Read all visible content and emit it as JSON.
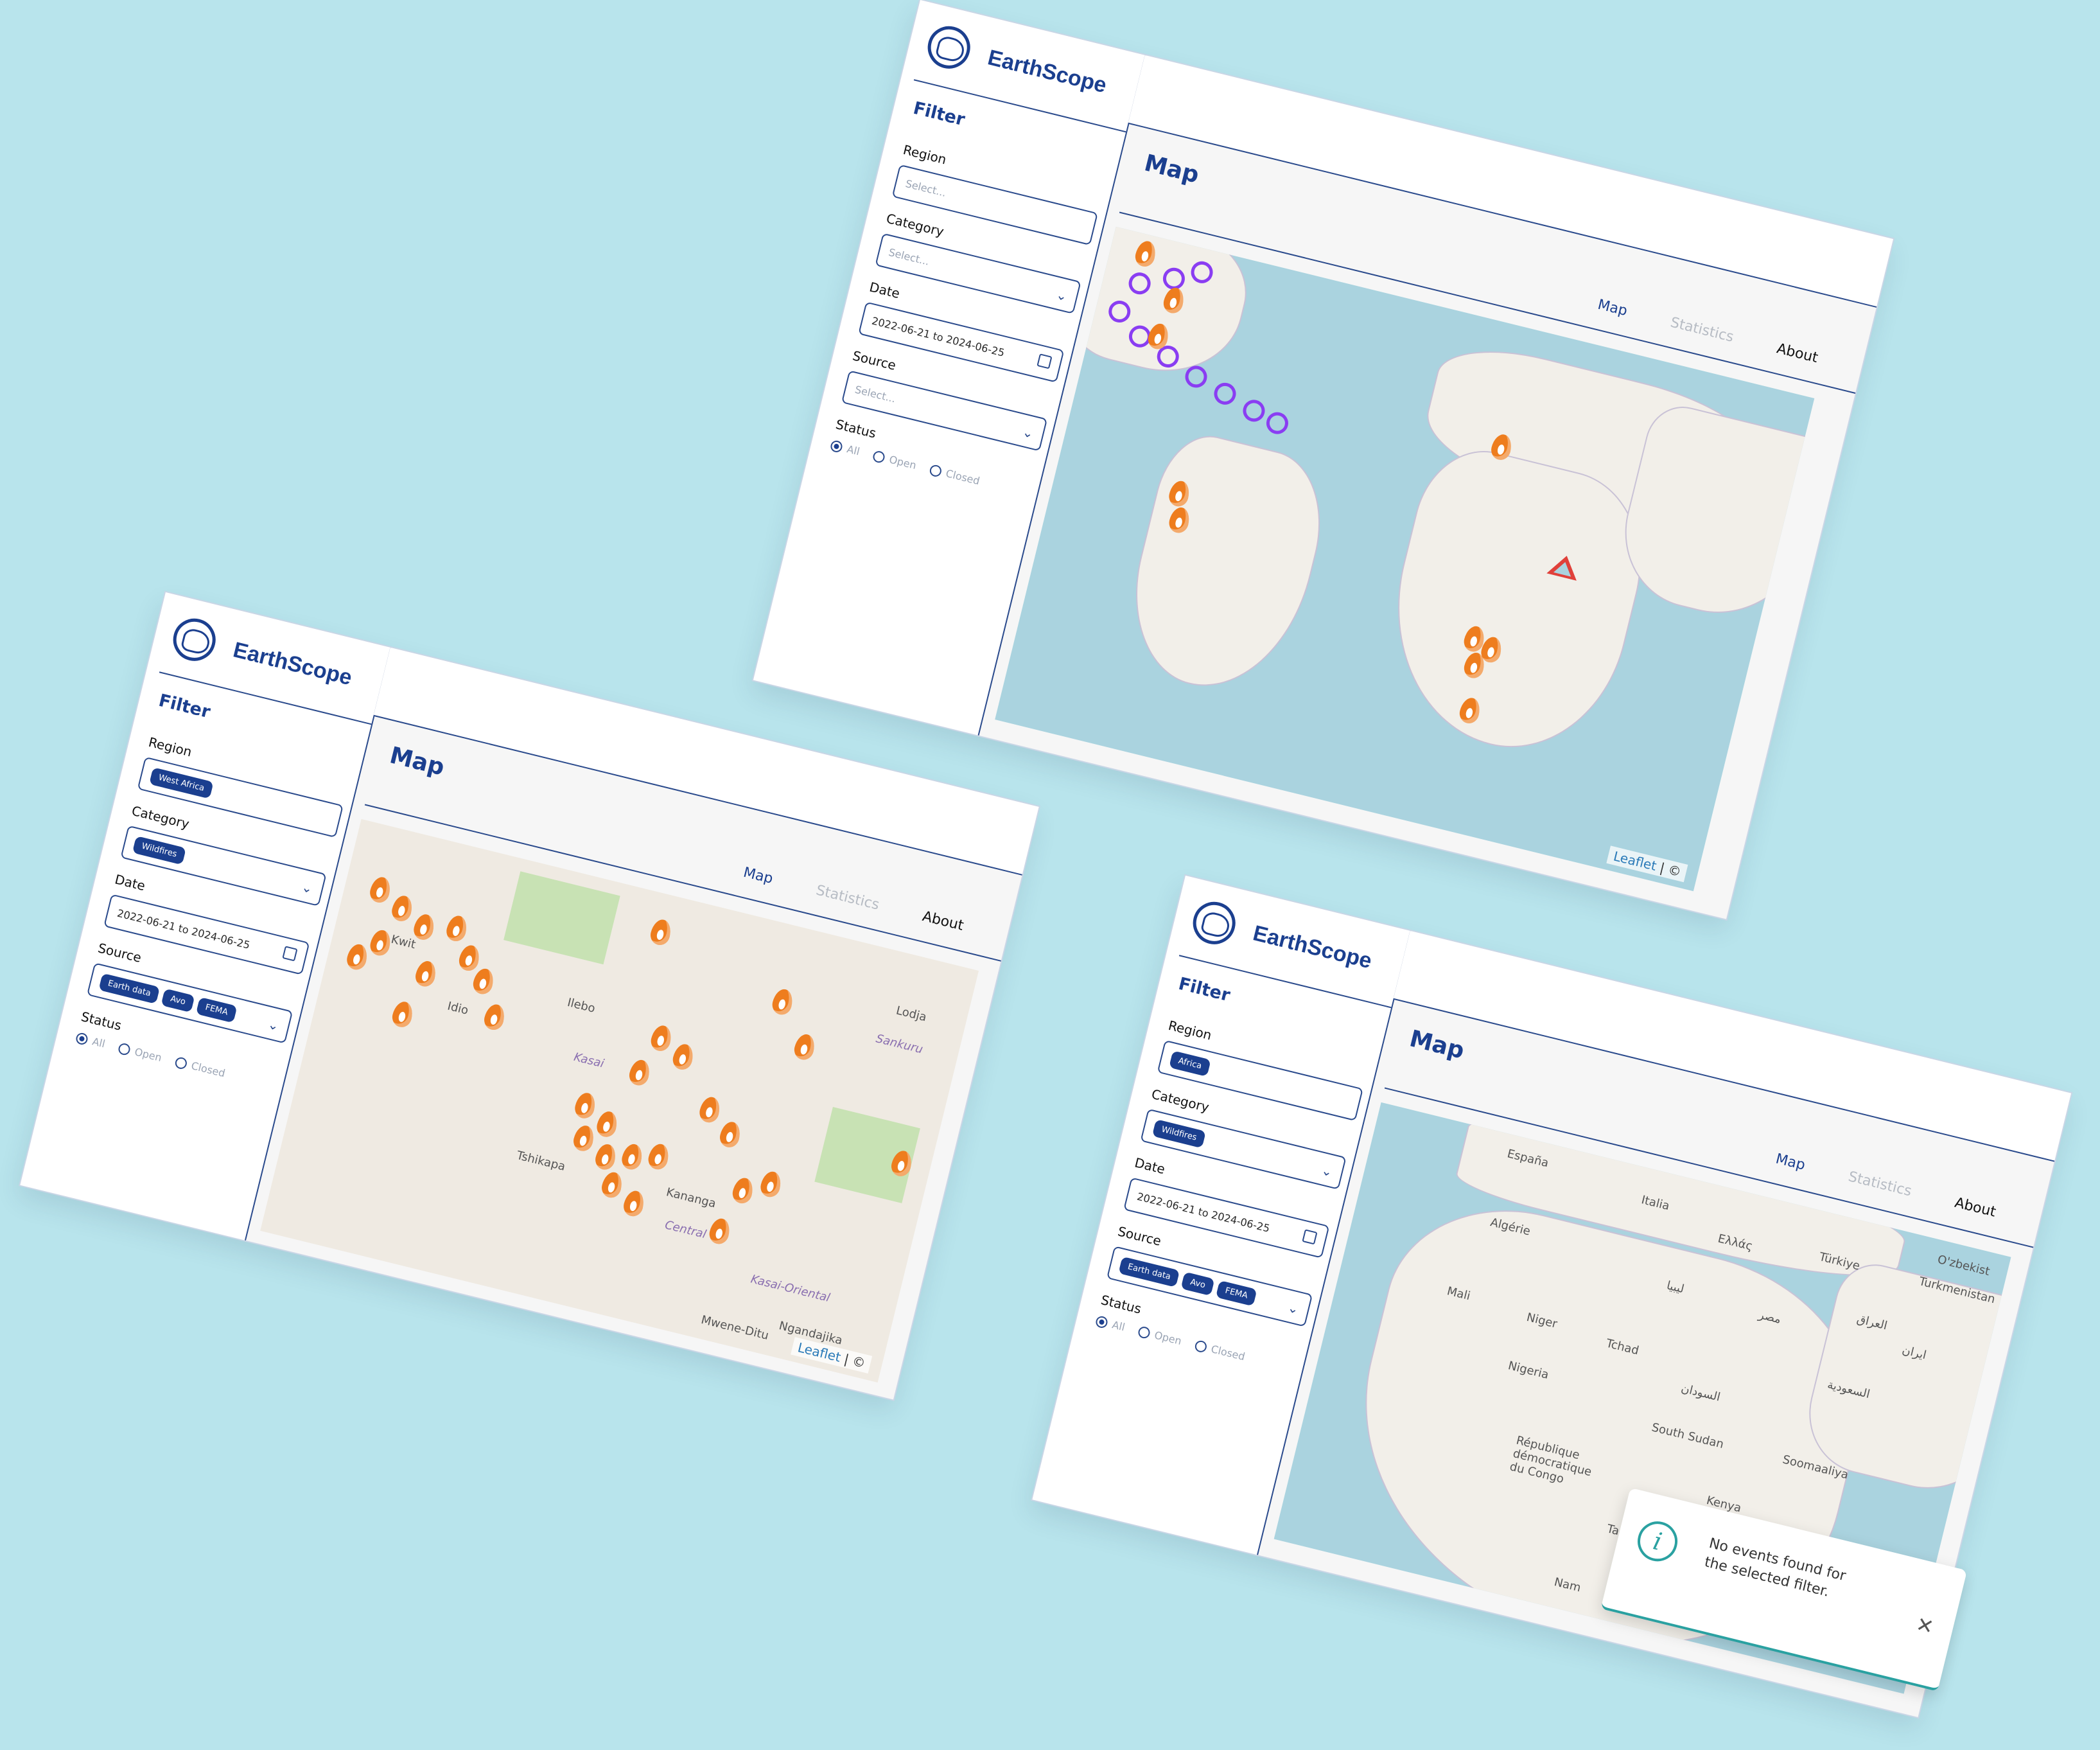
{
  "app": {
    "name": "EarthScope",
    "filter_title": "Filter",
    "labels": {
      "region": "Region",
      "category": "Category",
      "date": "Date",
      "source": "Source",
      "status": "Status"
    },
    "placeholder": "Select...",
    "date_value": "2022-06-21 to 2024-06-25",
    "status_options": [
      "All",
      "Open",
      "Closed"
    ],
    "main_title": "Map",
    "tabs": [
      "Map",
      "Statistics",
      "About"
    ],
    "attribution": {
      "leaflet": "Leaflet",
      "separator": " | ©"
    }
  },
  "screens": [
    {
      "region_chips": [],
      "category_chips": [],
      "source_chips": []
    },
    {
      "region_chips": [
        "West Africa"
      ],
      "category_chips": [
        "Wildfires"
      ],
      "source_chips": [
        "Earth data",
        "Avo",
        "FEMA"
      ],
      "map_labels": [
        "Ilebo",
        "Idio",
        "Kasai",
        "Lodja",
        "Sankuru",
        "Kananga",
        "Tshikapa",
        "Central",
        "Kasai-Oriental",
        "Ngandajika",
        "Mwene-Ditu",
        "Kwit"
      ]
    },
    {
      "region_chips": [
        "Africa"
      ],
      "category_chips": [
        "Wildfires"
      ],
      "source_chips": [
        "Earth data",
        "Avo",
        "FEMA"
      ],
      "map_labels": [
        "España",
        "Italia",
        "Ελλάς",
        "Türkiye",
        "Algérie",
        "Mali",
        "Niger",
        "Tchad",
        "Nigeria",
        "السودان",
        "South Sudan",
        "Kenya",
        "Soomaaliya",
        "République démocratique du Congo",
        "Tanzania",
        "Turkmenistan",
        "O'zbekist",
        "العراق",
        "ایران",
        "السعودية",
        "مصر",
        "ليبيا",
        "Nam"
      ]
    }
  ],
  "toast": {
    "message": "No events found for the selected filter."
  },
  "colors": {
    "brand": "#1b3f8f",
    "background": "#b8e4ec",
    "fire": "#ee7d1e",
    "storm": "#8a3df2",
    "volcano": "#e0403a",
    "toast_accent": "#2aa1a1"
  }
}
